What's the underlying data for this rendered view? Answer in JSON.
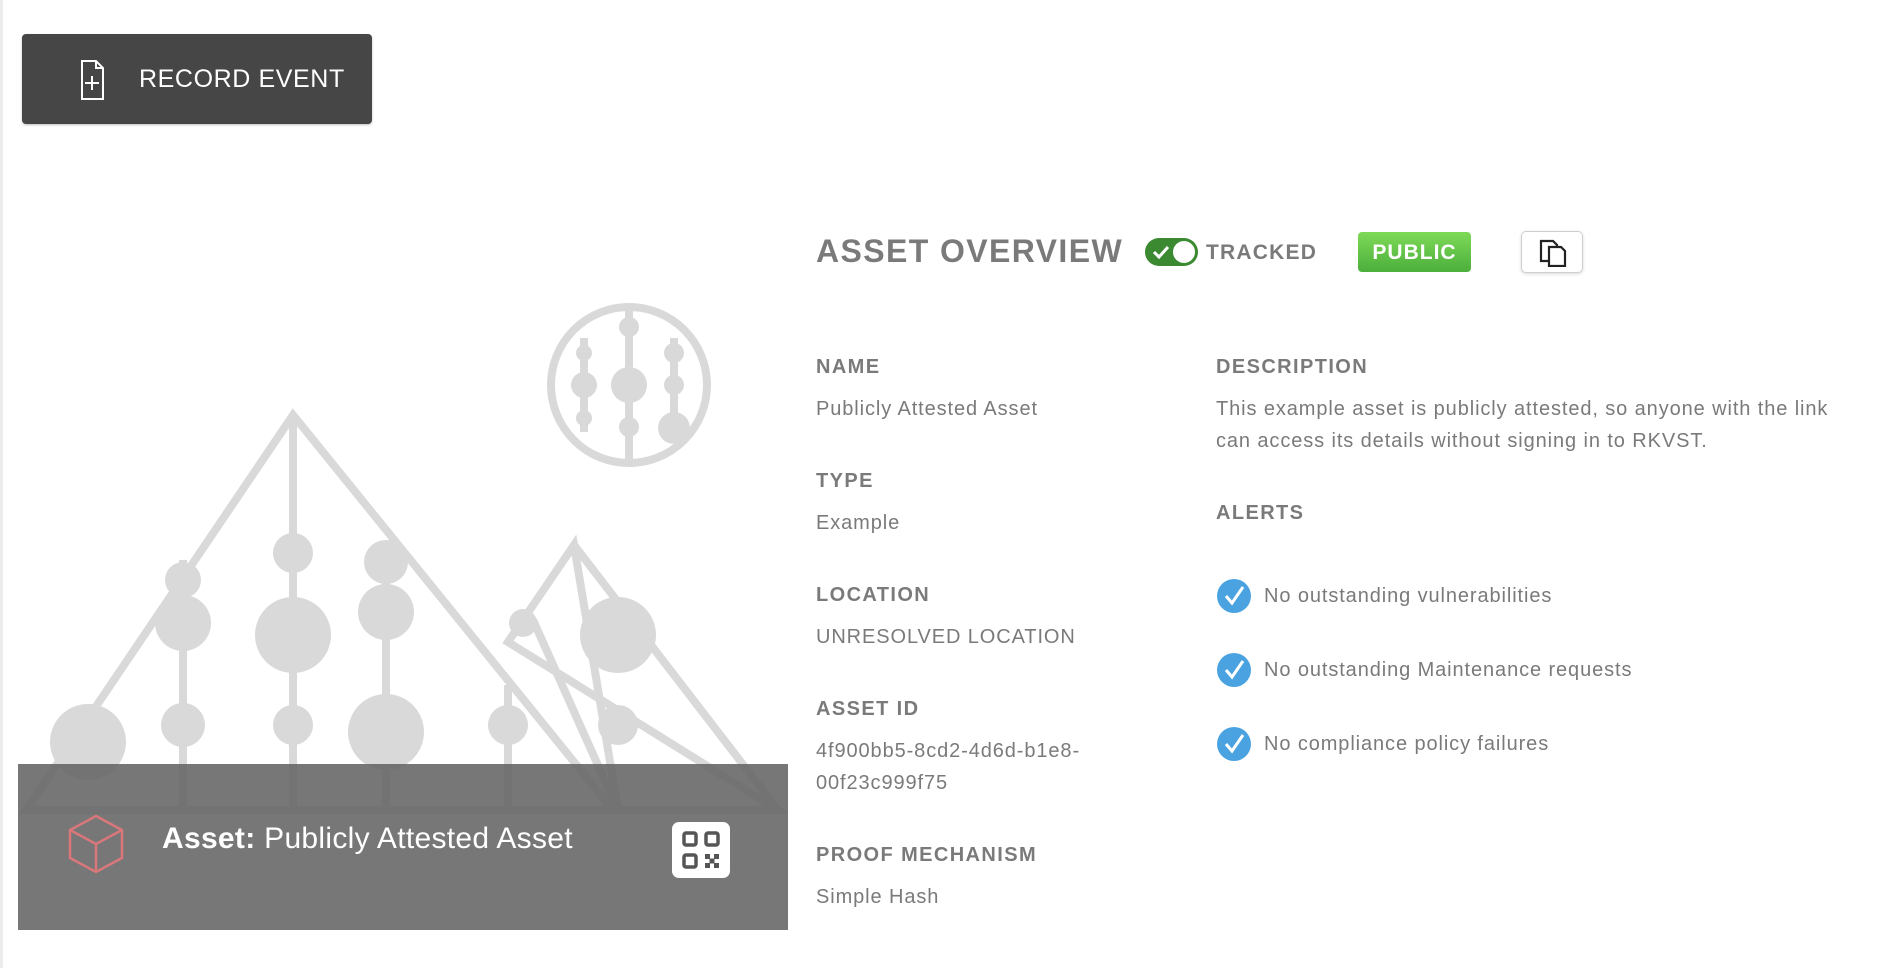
{
  "toolbar": {
    "record_event_label": "RECORD EVENT",
    "record_event_icon": "file-add-icon"
  },
  "asset_card": {
    "caption_prefix": "Asset:",
    "caption_name": "Publicly Attested Asset",
    "cube_icon": "cube-icon",
    "qr_icon": "qr-code-icon"
  },
  "overview": {
    "title": "ASSET OVERVIEW",
    "tracked_label": "TRACKED",
    "tracked_on": true,
    "public_badge": "PUBLIC",
    "copy_icon": "copy-icon"
  },
  "fields": {
    "name_label": "NAME",
    "name_value": "Publicly Attested Asset",
    "type_label": "TYPE",
    "type_value": "Example",
    "location_label": "LOCATION",
    "location_value": "UNRESOLVED LOCATION",
    "asset_id_label": "ASSET ID",
    "asset_id_line1": "4f900bb5-8cd2-4d6d-b1e8-",
    "asset_id_line2": "00f23c999f75",
    "proof_label": "PROOF MECHANISM",
    "proof_value": "Simple Hash",
    "description_label": "DESCRIPTION",
    "description_line1": "This example asset is publicly attested, so anyone with the link",
    "description_line2": "can access its details without signing in to RKVST.",
    "alerts_label": "ALERTS"
  },
  "alerts": [
    {
      "text": "No outstanding vulnerabilities",
      "icon": "check-circle-icon"
    },
    {
      "text": "No outstanding Maintenance requests",
      "icon": "check-circle-icon"
    },
    {
      "text": "No compliance policy failures",
      "icon": "check-circle-icon"
    }
  ],
  "colors": {
    "button_bg": "#464646",
    "toggle_on": "#3b8a32",
    "public_badge": "#5cbf45",
    "alert_check": "#4aa3e0",
    "text": "#7a7a7a"
  }
}
